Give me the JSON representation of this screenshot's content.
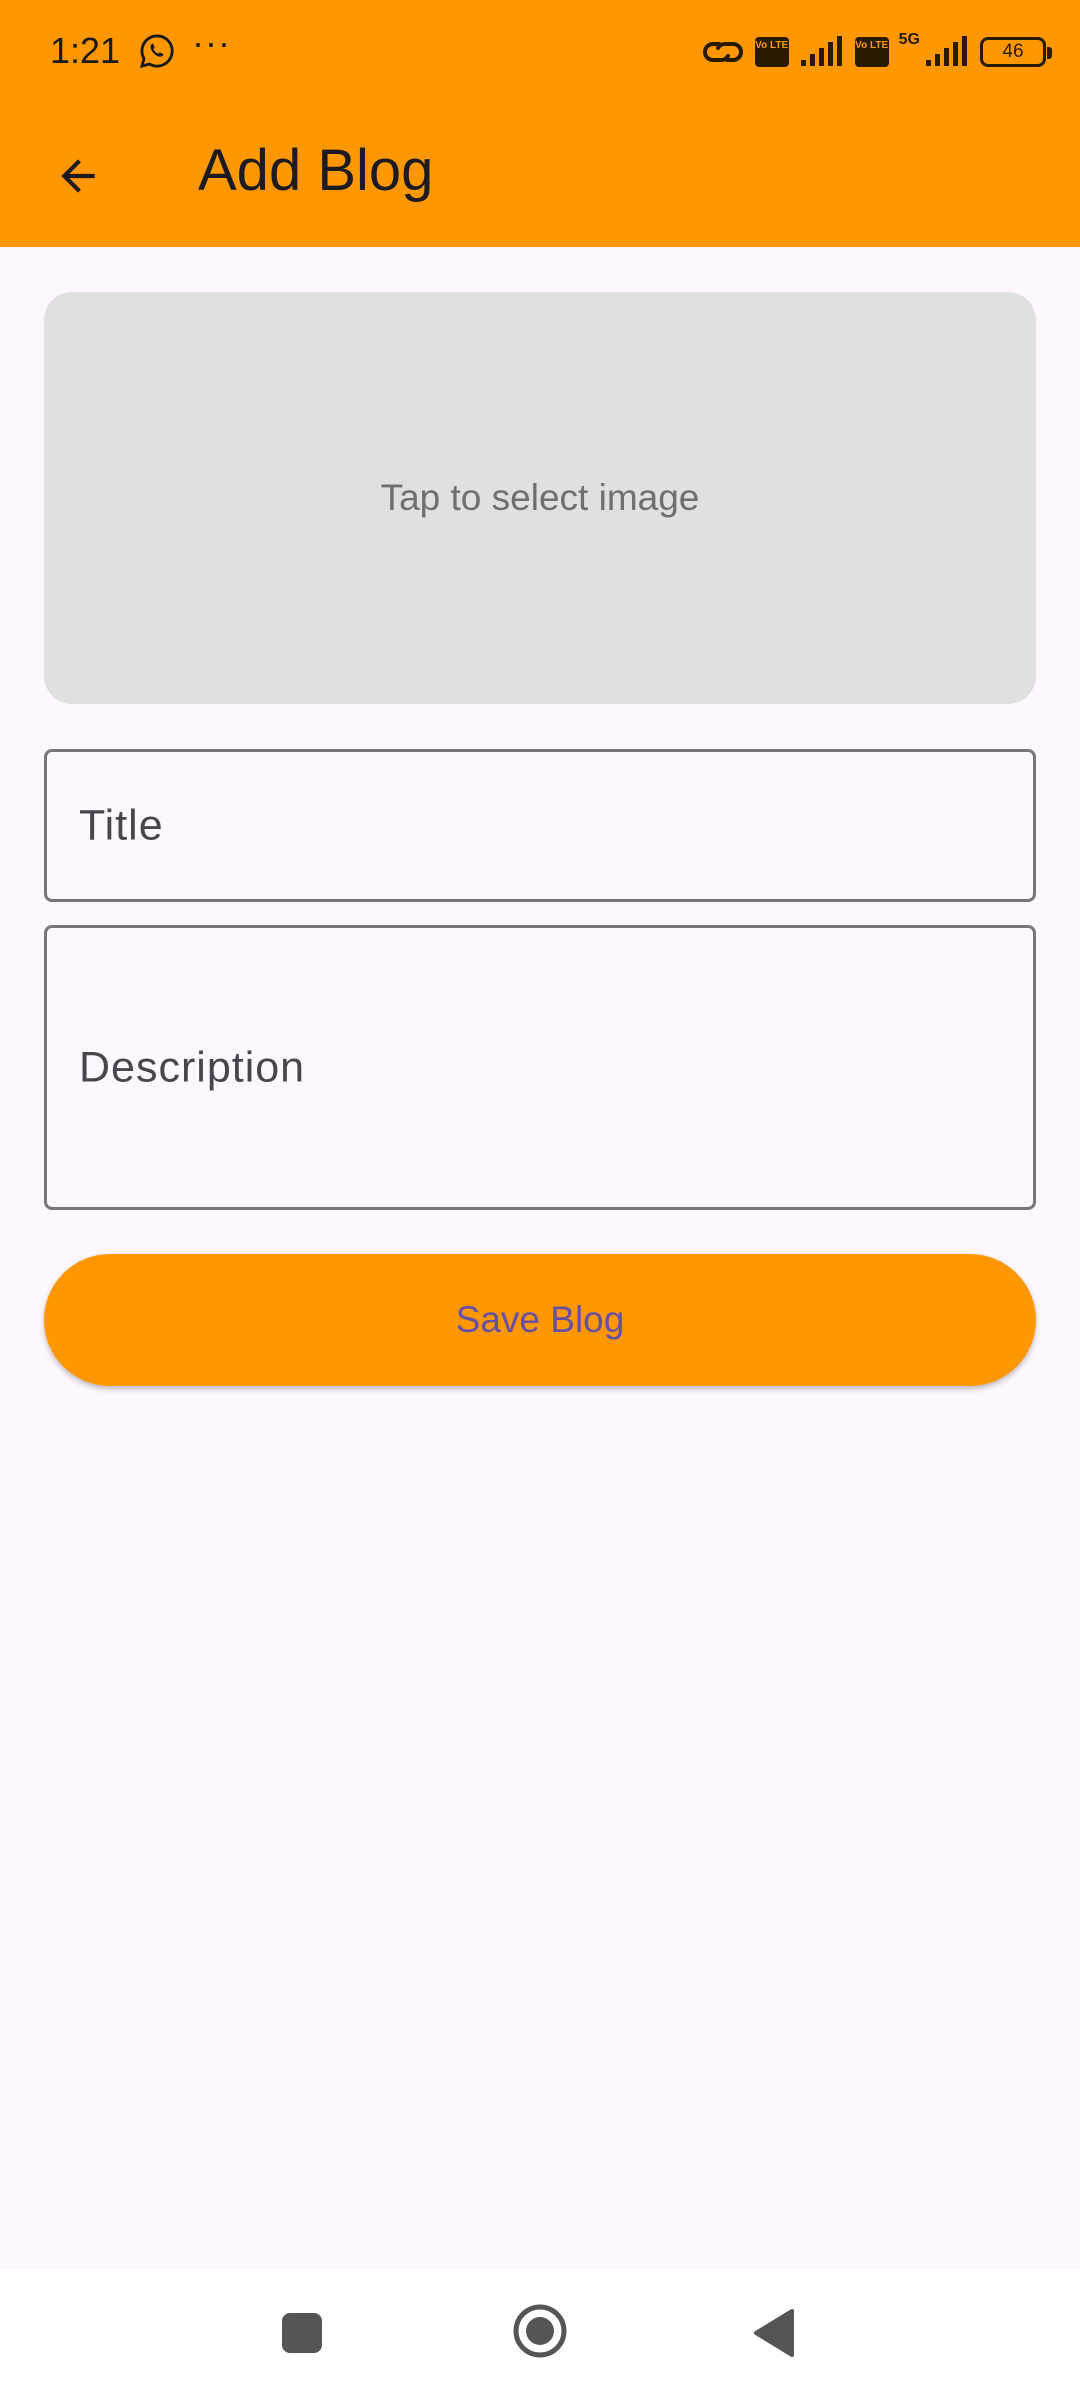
{
  "status_bar": {
    "time": "1:21",
    "dots": "···",
    "icons": [
      "whatsapp-icon",
      "link-icon",
      "volte-icon",
      "signal-icon",
      "volte-icon",
      "5g-signal-icon",
      "battery-icon"
    ],
    "volte_label": "Vo LTE",
    "network": "5G",
    "battery": "46"
  },
  "app_bar": {
    "title": "Add Blog",
    "back_icon": "arrow-back-icon"
  },
  "form": {
    "image_picker_label": "Tap to select image",
    "title_placeholder": "Title",
    "description_placeholder": "Description",
    "save_label": "Save Blog"
  },
  "nav_bar": {
    "icons": [
      "recents-square-icon",
      "home-circle-icon",
      "back-triangle-icon"
    ]
  },
  "colors": {
    "accent": "#FF9800",
    "background": "#FEF7FF",
    "image_placeholder": "#E0E0E0",
    "button_text": "#6750A4",
    "field_border": "#79747E"
  }
}
